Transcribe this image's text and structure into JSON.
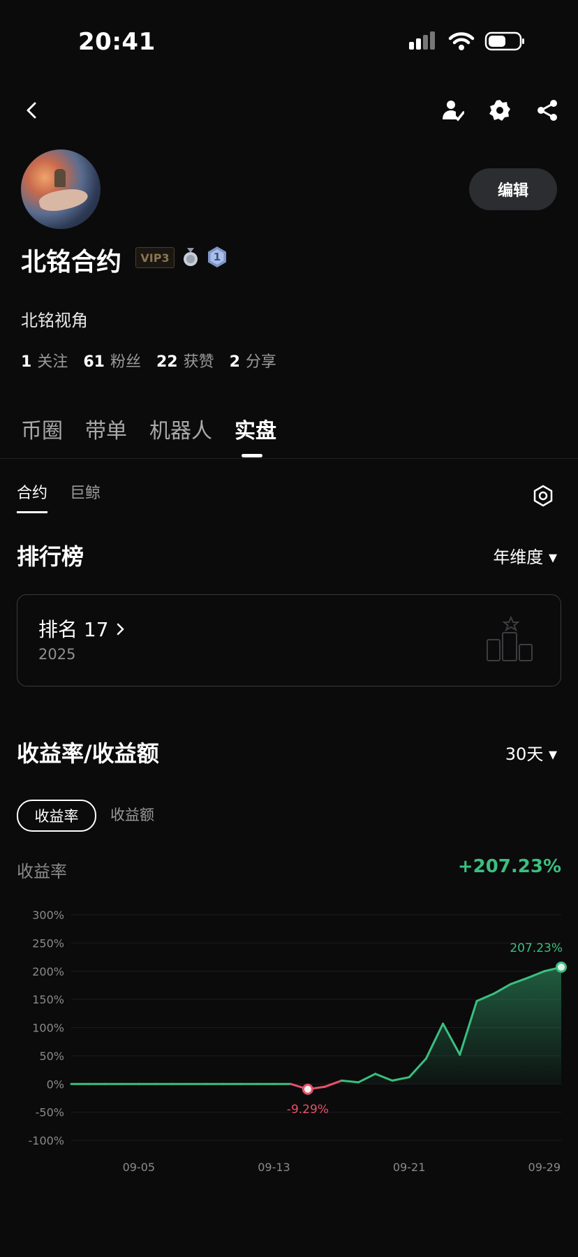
{
  "status_bar": {
    "time": "20:41"
  },
  "profile": {
    "name": "北铭合约",
    "vip": "VIP3",
    "level_badge": "1",
    "bio": "北铭视角",
    "edit_label": "编辑",
    "stats": [
      {
        "value": "1",
        "label": "关注"
      },
      {
        "value": "61",
        "label": "粉丝"
      },
      {
        "value": "22",
        "label": "获赞"
      },
      {
        "value": "2",
        "label": "分享"
      }
    ]
  },
  "main_tabs": [
    "币圈",
    "带单",
    "机器人",
    "实盘"
  ],
  "main_tabs_active": "实盘",
  "sub_tabs": [
    "合约",
    "巨鲸"
  ],
  "sub_tabs_active": "合约",
  "leaderboard": {
    "title": "排行榜",
    "period": "年维度 ▾",
    "rank_label": "排名 17",
    "year": "2025"
  },
  "returns": {
    "title": "收益率/收益额",
    "period": "30天 ▾",
    "toggle_active": "收益率",
    "toggle_inactive": "收益额",
    "metric_label": "收益率",
    "metric_value": "+207.23%"
  },
  "colors": {
    "positive": "#3bbf7f",
    "negative": "#e8516a"
  },
  "icons": [
    "back-icon",
    "add-user-icon",
    "gear-icon",
    "share-icon",
    "settings-hex-icon",
    "podium-icon"
  ],
  "chart_data": {
    "type": "line",
    "y_ticks": [
      "300%",
      "250%",
      "200%",
      "150%",
      "100%",
      "50%",
      "0%",
      "-50%",
      "-100%"
    ],
    "x_ticks": [
      "09-05",
      "09-13",
      "09-21",
      "09-29"
    ],
    "ylim": [
      -100,
      300
    ],
    "x": [
      "09-01",
      "09-02",
      "09-03",
      "09-04",
      "09-05",
      "09-06",
      "09-07",
      "09-08",
      "09-09",
      "09-10",
      "09-11",
      "09-12",
      "09-13",
      "09-14",
      "09-15",
      "09-16",
      "09-17",
      "09-18",
      "09-19",
      "09-20",
      "09-21",
      "09-22",
      "09-23",
      "09-24",
      "09-25",
      "09-26",
      "09-27",
      "09-28",
      "09-29",
      "09-30"
    ],
    "values": [
      0,
      0,
      0,
      0,
      0,
      0,
      0,
      0,
      0,
      0,
      0,
      0,
      0,
      0,
      -9.29,
      -5,
      6,
      3,
      18,
      6,
      12,
      45,
      107,
      52,
      147,
      160,
      177,
      188,
      200,
      207.23
    ],
    "annotations": [
      {
        "label": "-9.29%",
        "x": "09-15",
        "value": -9.29
      },
      {
        "label": "207.23%",
        "x": "09-30",
        "value": 207.23
      }
    ]
  }
}
